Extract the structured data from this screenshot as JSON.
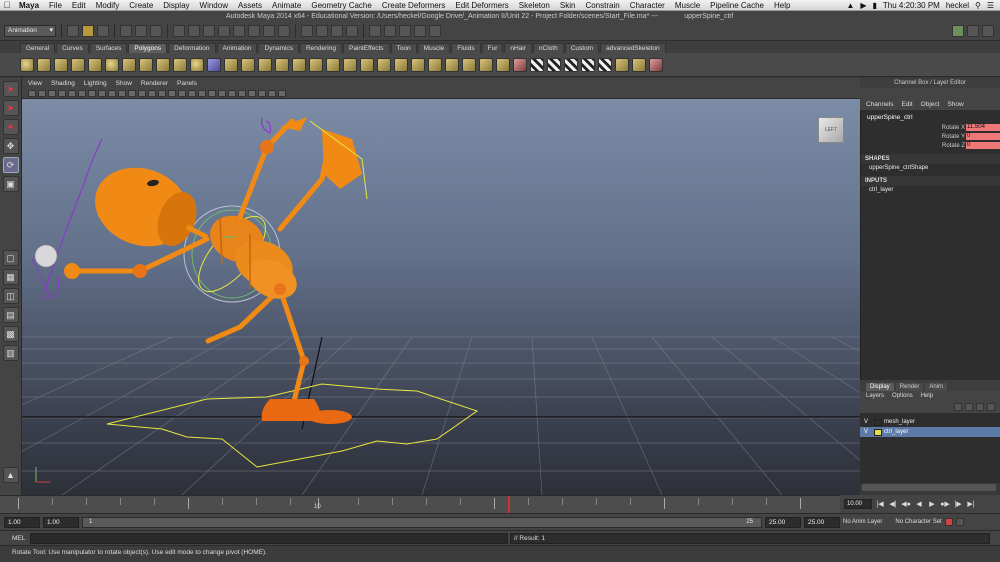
{
  "macmenu": {
    "app": "Maya",
    "items": [
      "File",
      "Edit",
      "Modify",
      "Create",
      "Display",
      "Window",
      "Assets",
      "Animate",
      "Geometry Cache",
      "Create Deformers",
      "Edit Deformers",
      "Skeleton",
      "Skin",
      "Constrain",
      "Character",
      "Muscle",
      "Pipeline Cache",
      "Help"
    ],
    "clock": "Thu 4:20:30 PM",
    "user": "heckel"
  },
  "window": {
    "title": "Autodesk Maya 2014 x64 - Educational Version: /Users/heckel/Google Drive/_Animation II/Unit 22 - Project Folder/scenes/Start_File.ma*  ---",
    "selection": "upperSpine_ctrl"
  },
  "statusline": {
    "mode": "Animation"
  },
  "shelf": {
    "tabs": [
      "General",
      "Curves",
      "Surfaces",
      "Polygons",
      "Deformation",
      "Animation",
      "Dynamics",
      "Rendering",
      "PaintEffects",
      "Toon",
      "Muscle",
      "Fluids",
      "Fur",
      "nHair",
      "nCloth",
      "Custom",
      "advancedSkeleton"
    ],
    "active_tab": "Polygons"
  },
  "panel": {
    "menu": [
      "View",
      "Shading",
      "Lighting",
      "Show",
      "Renderer",
      "Panels"
    ],
    "viewcube_label": "LEFT"
  },
  "channelbox": {
    "header": "Channel Box / Layer Editor",
    "menu": [
      "Channels",
      "Edit",
      "Object",
      "Show"
    ],
    "node": "upperSpine_ctrl",
    "attributes": [
      {
        "name": "Rotate X",
        "value": "11.504"
      },
      {
        "name": "Rotate Y",
        "value": "0"
      },
      {
        "name": "Rotate Z",
        "value": "0"
      }
    ],
    "shapes_header": "SHAPES",
    "shape": "upperSpine_ctrlShape",
    "inputs_header": "INPUTS",
    "input": "ctrl_layer"
  },
  "layers": {
    "tabs": [
      "Display",
      "Render",
      "Anim"
    ],
    "menu": [
      "Layers",
      "Options",
      "Help"
    ],
    "items": [
      {
        "vis": "V",
        "name": "mesh_layer",
        "color": "#2e2e2e"
      },
      {
        "vis": "V",
        "name": "ctrl_layer",
        "color": "#e6e04a"
      }
    ]
  },
  "timeslider": {
    "labels": [
      "10"
    ],
    "current_frame": "10.00"
  },
  "range": {
    "start": "1.00",
    "playback_start": "1.00",
    "slider_start": "1",
    "slider_end": "25",
    "playback_end": "25.00",
    "end": "25.00",
    "anim_layer": "No Anim Layer",
    "char_set": "No Character Set"
  },
  "cmdline": {
    "label": "MEL",
    "result": "// Result: 1"
  },
  "helpline": {
    "text": "Rotate Tool: Use manipulator to rotate object(s). Use edit mode to change pivot (HOME)."
  },
  "colors": {
    "character": "#f08a14",
    "control_curve_yellow": "#e8e640",
    "control_curve_purple": "#8a3cc8",
    "viewport_top": "#7c8ca6"
  }
}
